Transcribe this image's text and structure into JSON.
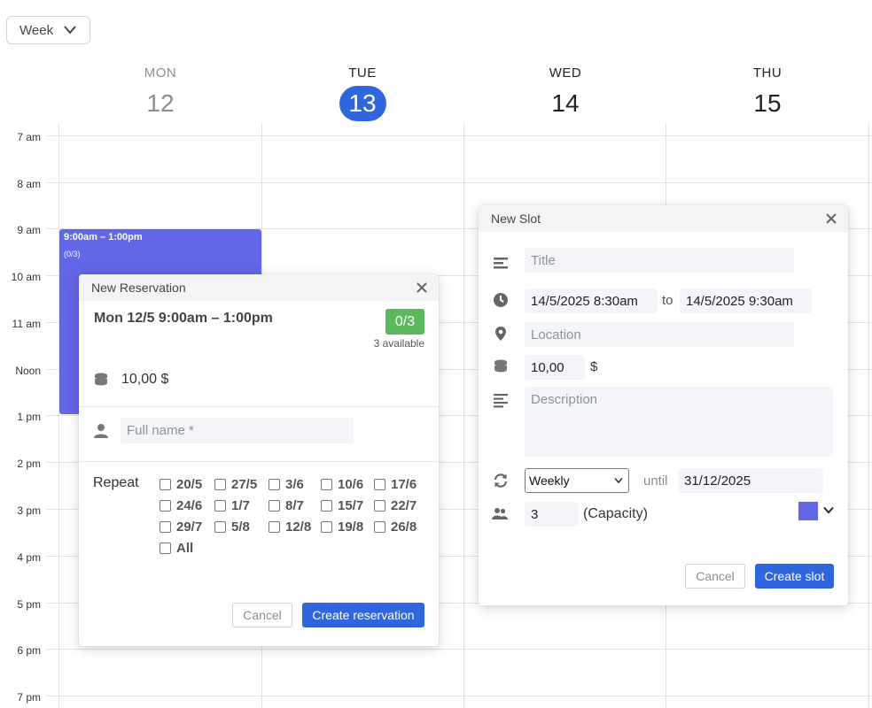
{
  "view_select": {
    "value": "Week"
  },
  "days": [
    {
      "dow": "MON",
      "num": "12"
    },
    {
      "dow": "TUE",
      "num": "13"
    },
    {
      "dow": "WED",
      "num": "14"
    },
    {
      "dow": "THU",
      "num": "15"
    }
  ],
  "hours": [
    "7 am",
    "8 am",
    "9 am",
    "10 am",
    "11 am",
    "Noon",
    "1 pm",
    "2 pm",
    "3 pm",
    "4 pm",
    "5 pm",
    "6 pm",
    "7 pm"
  ],
  "event": {
    "time": "9:00am – 1:00pm",
    "count": "(0/3)",
    "color": "#6466e8"
  },
  "reservation": {
    "title": "New Reservation",
    "slot": "Mon 12/5  9:00am – 1:00pm",
    "badge": "0/3",
    "available": "3 available",
    "price": "10,00 $",
    "full_name_placeholder": "Full name *",
    "repeat_label": "Repeat",
    "dates": [
      "20/5",
      "27/5",
      "3/6",
      "10/6",
      "17/6",
      "24/6",
      "1/7",
      "8/7",
      "15/7",
      "22/7",
      "29/7",
      "5/8",
      "12/8",
      "19/8",
      "26/8"
    ],
    "all_label": "All",
    "cancel": "Cancel",
    "submit": "Create reservation"
  },
  "slot": {
    "title": "New Slot",
    "title_placeholder": "Title",
    "start": "14/5/2025 8:30am",
    "to": "to",
    "end": "14/5/2025 9:30am",
    "location_placeholder": "Location",
    "price": "10,00",
    "currency": "$",
    "description_placeholder": "Description",
    "repeat": "Weekly",
    "until_label": "until",
    "until": "31/12/2025",
    "capacity": "3",
    "capacity_label": "(Capacity)",
    "color": "#6466e8",
    "cancel": "Cancel",
    "submit": "Create slot"
  },
  "colors": {
    "accent": "#2f66de",
    "badge": "#5cb85c",
    "event": "#6466e8"
  }
}
